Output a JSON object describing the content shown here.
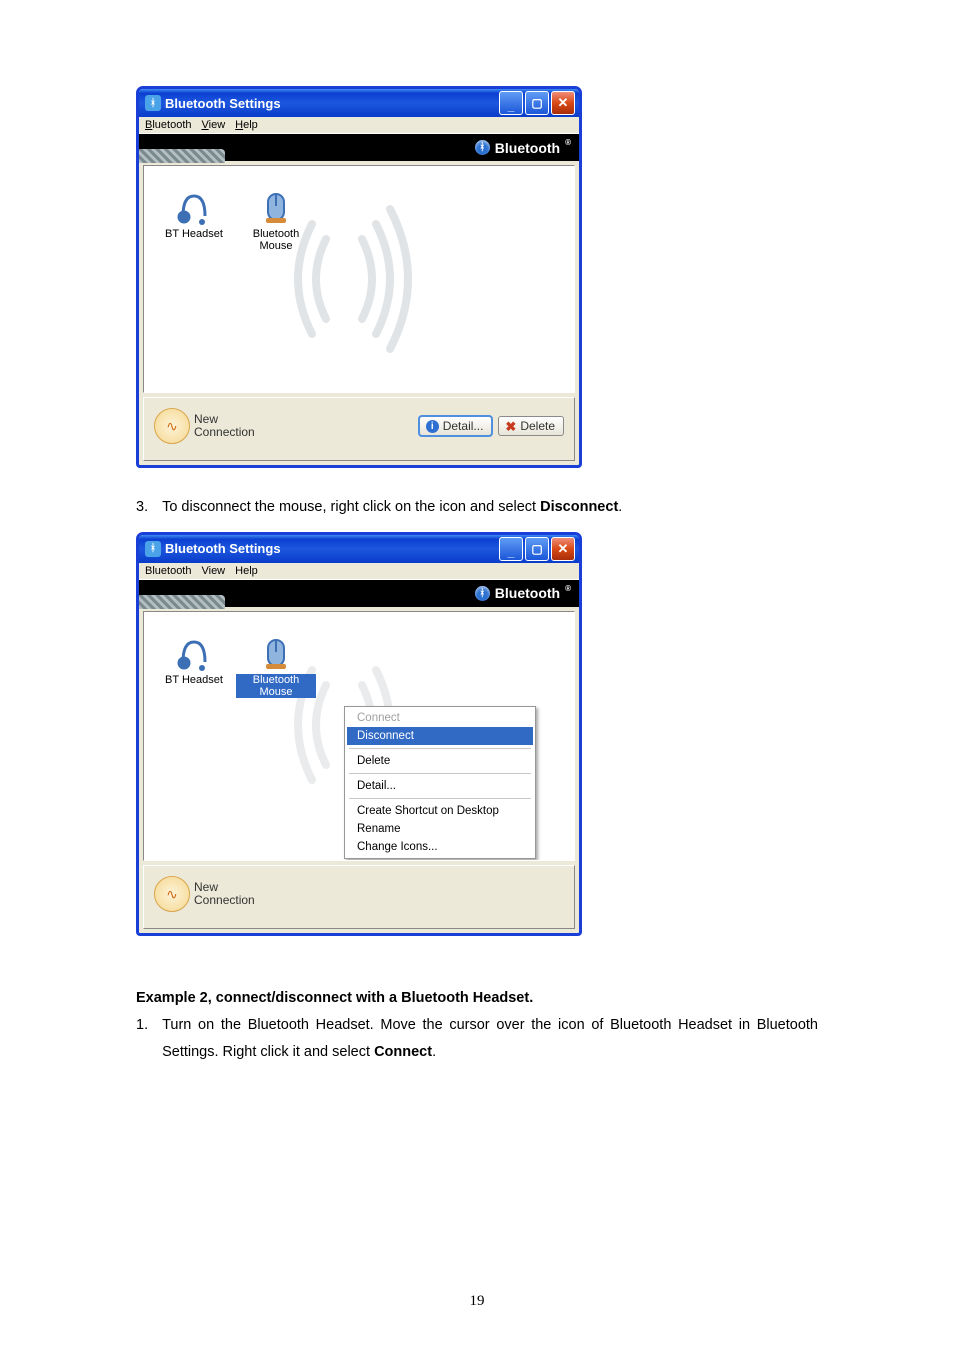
{
  "page_number": "19",
  "window1": {
    "title": "Bluetooth Settings",
    "menu": {
      "bluetooth": "Bluetooth",
      "view": "View",
      "help": "Help"
    },
    "brand": "Bluetooth",
    "devices": [
      {
        "label": "BT Headset"
      },
      {
        "label": "Bluetooth Mouse"
      }
    ],
    "new_connection_l1": "New",
    "new_connection_l2": "Connection",
    "detail_btn": "Detail...",
    "delete_btn": "Delete"
  },
  "step3": {
    "num": "3.",
    "text_before": "To disconnect the mouse, right click on the icon and select ",
    "bold": "Disconnect",
    "after": "."
  },
  "window2": {
    "title": "Bluetooth Settings",
    "menu": {
      "bluetooth": "Bluetooth",
      "view": "View",
      "help": "Help"
    },
    "brand": "Bluetooth",
    "devices": [
      {
        "label": "BT Headset"
      },
      {
        "label": "Bluetooth Mouse",
        "selected": true
      }
    ],
    "new_connection_l1": "New",
    "new_connection_l2": "Connection",
    "context": {
      "connect": "Connect",
      "disconnect": "Disconnect",
      "delete": "Delete",
      "detail": "Detail...",
      "create_shortcut": "Create Shortcut on Desktop",
      "rename": "Rename",
      "change_icons": "Change Icons..."
    }
  },
  "example2": {
    "heading": "Example 2, connect/disconnect with a Bluetooth Headset.",
    "num": "1.",
    "text_before": "Turn on the Bluetooth Headset. Move the cursor over the icon of Bluetooth Headset in Bluetooth Settings. Right click it and select ",
    "bold": "Connect",
    "after": "."
  }
}
